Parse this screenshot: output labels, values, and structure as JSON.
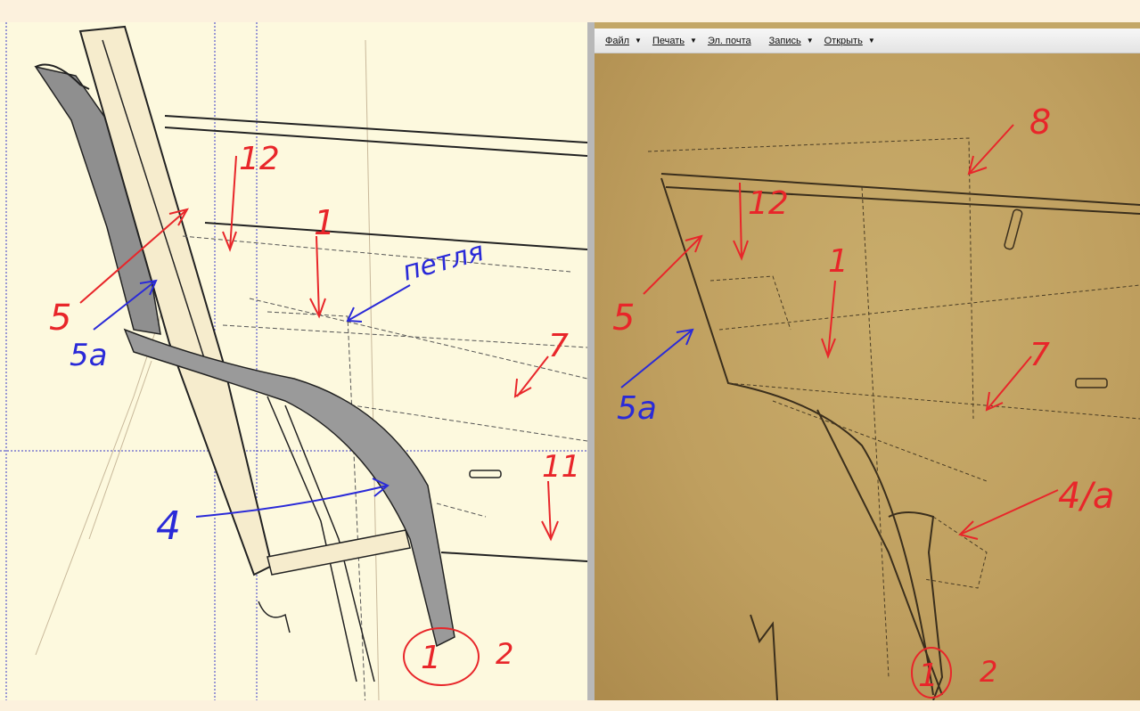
{
  "toolbar": {
    "items": [
      {
        "label": "Файл",
        "dropdown": true
      },
      {
        "label": "Печать",
        "dropdown": true
      },
      {
        "label": "Эл. почта",
        "dropdown": false
      },
      {
        "label": "Запись",
        "dropdown": true
      },
      {
        "label": "Открыть",
        "dropdown": true
      }
    ]
  },
  "left_drawing": {
    "labels": {
      "n12": "12",
      "n1": "1",
      "petlya": "петля",
      "n5": "5",
      "n5a": "5a",
      "n7": "7",
      "n11": "11",
      "n4": "4",
      "n1_circled": "1",
      "n2": "2"
    }
  },
  "right_photo": {
    "labels": {
      "n8": "8",
      "n12": "12",
      "n1": "1",
      "n5": "5",
      "n5a": "5a",
      "n7": "7",
      "n4a": "4/a",
      "n1_circled": "1",
      "n2": "2"
    }
  },
  "colors": {
    "annotation_red": "#e8262a",
    "annotation_blue": "#2a2ad8",
    "paper": "#fdf9de",
    "photo": "#c3a767"
  }
}
